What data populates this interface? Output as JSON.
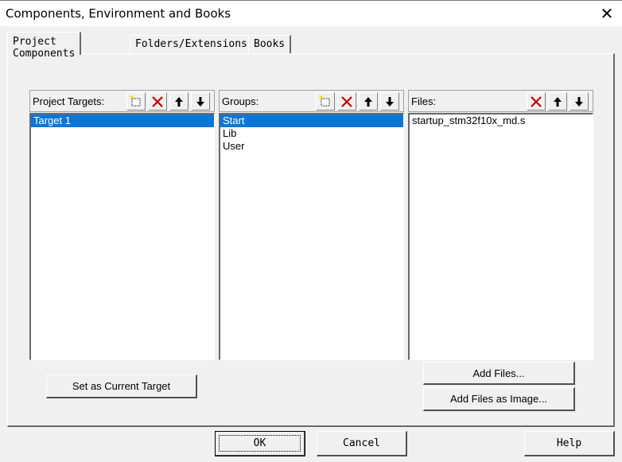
{
  "window": {
    "title": "Components, Environment and Books",
    "close_glyph": "✕"
  },
  "tabs": [
    {
      "label": "Project Components"
    },
    {
      "label": "Folders/Extensions"
    },
    {
      "label": "Books"
    }
  ],
  "project_targets": {
    "label": "Project Targets:",
    "toolbar": [
      "new-icon",
      "delete-icon",
      "move-up-icon",
      "move-down-icon"
    ],
    "items": [
      {
        "label": "Target 1",
        "selected": true
      }
    ]
  },
  "groups": {
    "label": "Groups:",
    "toolbar": [
      "new-icon",
      "delete-icon",
      "move-up-icon",
      "move-down-icon"
    ],
    "items": [
      {
        "label": "Start",
        "selected": true
      },
      {
        "label": "Lib",
        "selected": false
      },
      {
        "label": "User",
        "selected": false
      }
    ]
  },
  "files": {
    "label": "Files:",
    "toolbar": [
      "delete-icon",
      "move-up-icon",
      "move-down-icon"
    ],
    "items": [
      {
        "label": "startup_stm32f10x_md.s",
        "selected": false
      }
    ]
  },
  "buttons": {
    "set_current_target": "Set as Current Target",
    "add_files": "Add Files...",
    "add_files_image": "Add Files as Image...",
    "ok": "OK",
    "cancel": "Cancel",
    "help": "Help"
  },
  "colors": {
    "selection": "#0a76d8",
    "delete_icon": "#c00000",
    "new_icon_dots": "#ffd700"
  }
}
